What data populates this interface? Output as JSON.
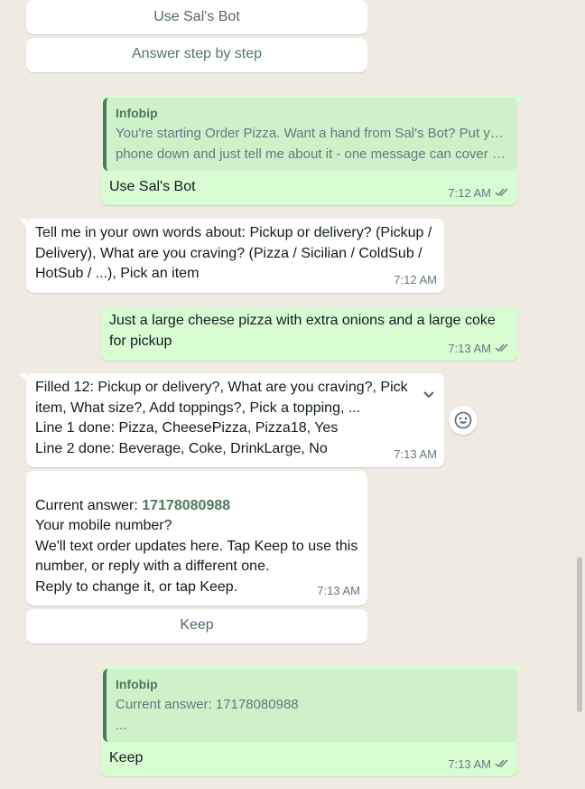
{
  "buttons": {
    "use_bot": "Use Sal's Bot",
    "step_by_step": "Answer step by step",
    "keep": "Keep"
  },
  "messages": {
    "m1": {
      "quote_name": "Infobip",
      "quote_line1": "You're starting Order Pizza. Want a hand from Sal's Bot? Put your",
      "quote_line2": "phone down and just tell me about it - one message can cover a...",
      "text": "Use Sal's Bot",
      "time": "7:12 AM"
    },
    "m2": {
      "text": "Tell me in your own words about: Pickup or delivery? (Pickup /\nDelivery), What are you craving? (Pizza / Sicilian / ColdSub /\nHotSub / ...), Pick an item",
      "time": "7:12 AM"
    },
    "m3": {
      "text": "Just a large cheese pizza with extra onions and a large coke\nfor pickup",
      "time": "7:13 AM"
    },
    "m4": {
      "text": "Filled 12: Pickup or delivery?, What are you craving?, Pick\nitem, What size?, Add toppings?, Pick a topping, ...\nLine 1 done: Pizza, CheesePizza, Pizza18, Yes\nLine 2 done: Beverage, Coke, DrinkLarge, No",
      "time": "7:13 AM"
    },
    "m5": {
      "label": "Current answer: ",
      "value": "17178080988",
      "body": "Your mobile number?\nWe'll text order updates here. Tap Keep to use this\nnumber, or reply with a different one.\nReply to change it, or tap Keep.",
      "time": "7:13 AM"
    },
    "m6": {
      "quote_name": "Infobip",
      "quote_line1": "Current answer: 17178080988",
      "quote_line2": "...",
      "text": "Keep",
      "time": "7:13 AM"
    }
  },
  "icons": {
    "read_receipt": "double-check-icon",
    "emoji": "smiley-icon",
    "menu": "chevron-down-icon"
  },
  "colors": {
    "background": "#efeae2",
    "outgoing": "#d9fdd3",
    "incoming": "#ffffff",
    "accent": "#51785f",
    "read_tick": "#667781"
  }
}
